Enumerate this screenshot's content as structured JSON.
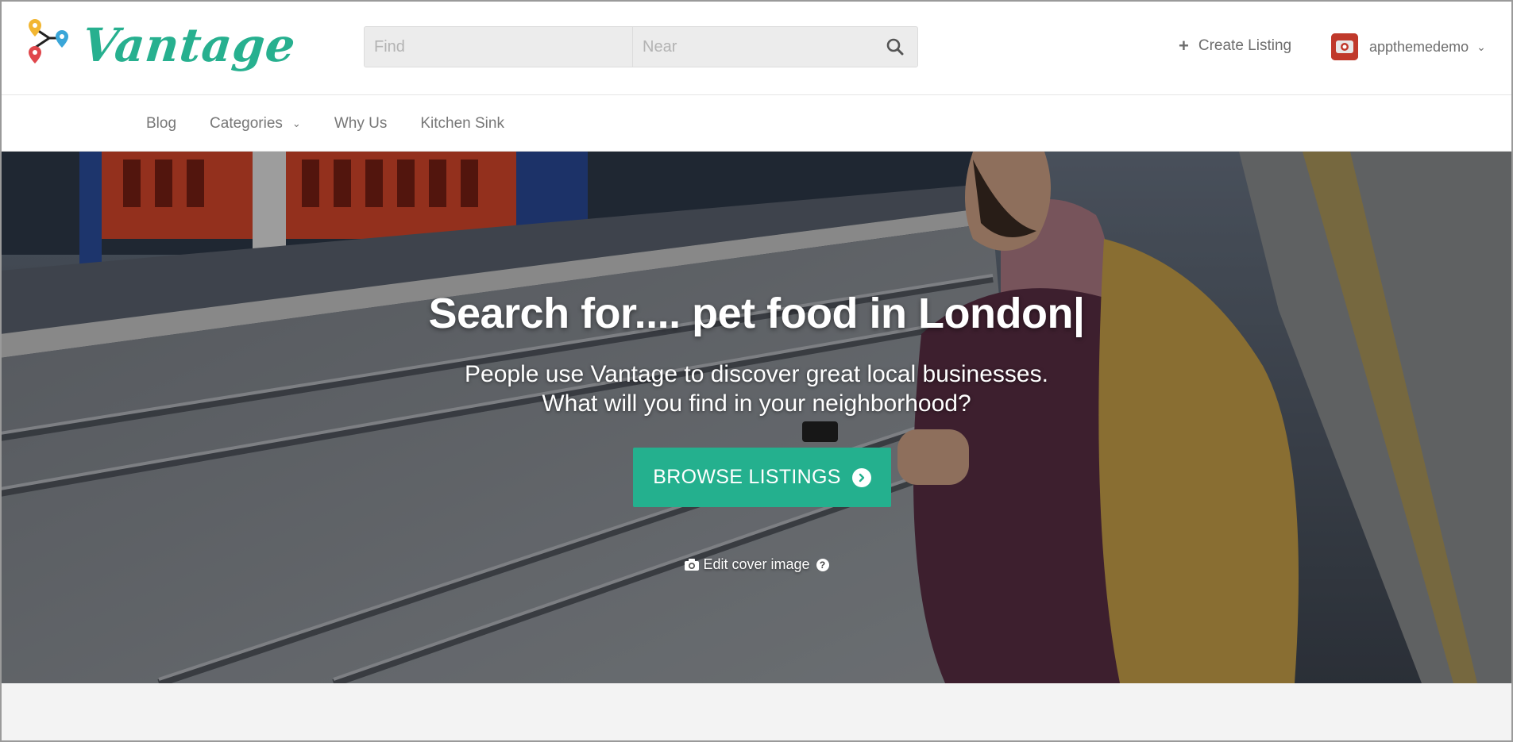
{
  "brand": {
    "name": "Vantage",
    "color": "#27b08f"
  },
  "search": {
    "find_placeholder": "Find",
    "near_placeholder": "Near",
    "icon": "search-icon"
  },
  "header": {
    "create_listing_label": "Create Listing",
    "create_listing_icon": "plus-icon",
    "username": "appthemedemo",
    "user_menu_icon": "chevron-down-icon"
  },
  "nav": {
    "items": [
      {
        "label": "Blog"
      },
      {
        "label": "Categories",
        "has_dropdown": true
      },
      {
        "label": "Why Us"
      },
      {
        "label": "Kitchen Sink"
      }
    ]
  },
  "hero": {
    "title": "Search for.... pet food in London|",
    "subtitle_line1": "People use Vantage to discover great local businesses.",
    "subtitle_line2": "What will you find in your neighborhood?",
    "button_label": "BROWSE LISTINGS",
    "button_color": "#24b08e",
    "edit_cover_label": "Edit cover image",
    "edit_cover_icon": "camera-icon",
    "help_icon": "help-icon"
  }
}
